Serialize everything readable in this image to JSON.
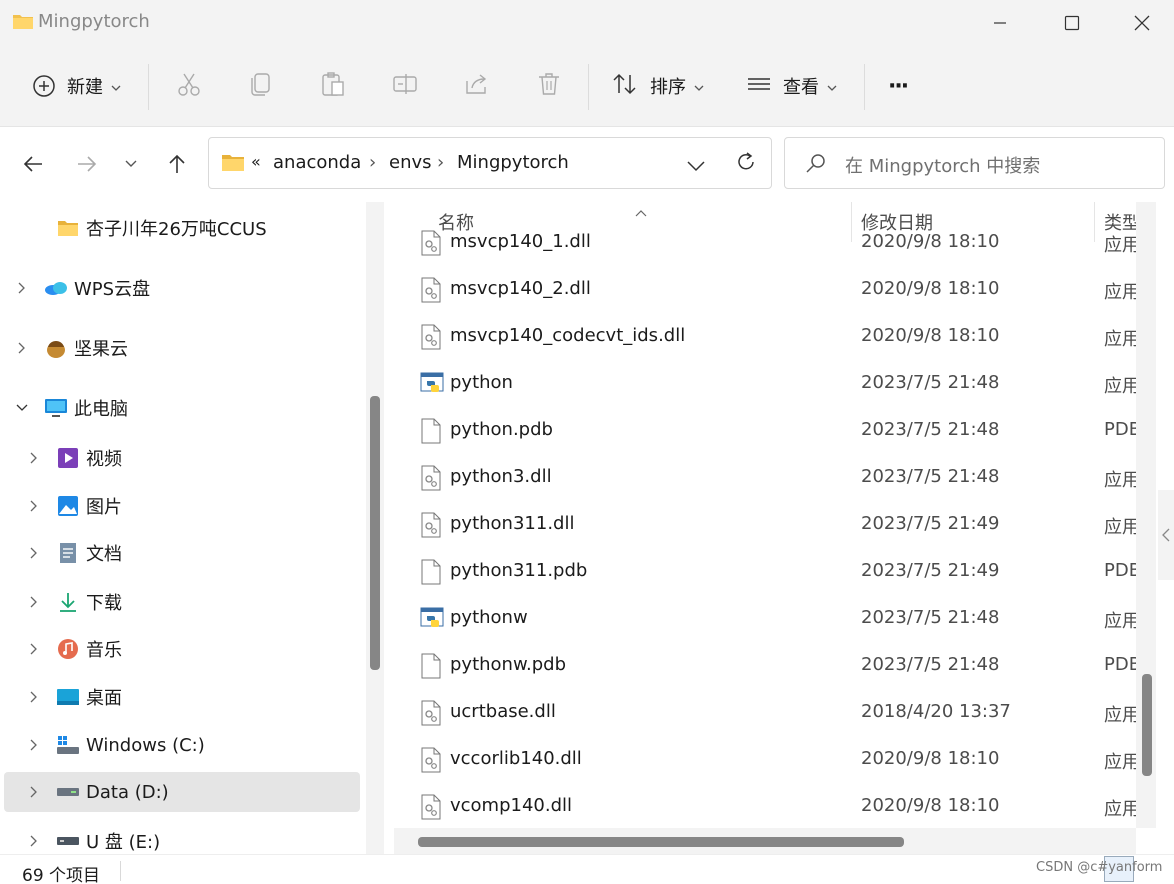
{
  "window": {
    "title": "Mingpytorch",
    "minimize_icon": "minimize-icon",
    "maximize_icon": "maximize-icon",
    "close_icon": "close-icon"
  },
  "toolbar": {
    "new_label": "新建",
    "sort_label": "排序",
    "view_label": "查看",
    "more_label": "···",
    "icons": [
      "cut-icon",
      "copy-icon",
      "paste-icon",
      "rename-icon",
      "share-icon",
      "delete-icon"
    ]
  },
  "nav": {
    "breadcrumb_overflow": "«",
    "breadcrumbs": [
      "anaconda",
      "envs",
      "Mingpytorch"
    ],
    "search_placeholder": "在 Mingpytorch 中搜索"
  },
  "sidebar": {
    "items": [
      {
        "label": "杏子川年26万吨CCUS",
        "icon": "folder-icon"
      },
      {
        "label": "WPS云盘",
        "icon": "cloud-icon"
      },
      {
        "label": "坚果云",
        "icon": "nut-icon"
      },
      {
        "label": "此电脑",
        "icon": "computer-icon"
      },
      {
        "label": "视频",
        "icon": "video-icon"
      },
      {
        "label": "图片",
        "icon": "picture-icon"
      },
      {
        "label": "文档",
        "icon": "document-icon"
      },
      {
        "label": "下载",
        "icon": "download-icon"
      },
      {
        "label": "音乐",
        "icon": "music-icon"
      },
      {
        "label": "桌面",
        "icon": "desktop-icon"
      },
      {
        "label": "Windows (C:)",
        "icon": "drive-c-icon"
      },
      {
        "label": "Data (D:)",
        "icon": "drive-icon"
      },
      {
        "label": "U 盘 (E:)",
        "icon": "usb-drive-icon"
      }
    ]
  },
  "columns": {
    "name": "名称",
    "date": "修改日期",
    "type": "类型"
  },
  "files": [
    {
      "name": "msvcp140_1.dll",
      "date": "2020/9/8 18:10",
      "type": "应用",
      "icon": "dll-icon"
    },
    {
      "name": "msvcp140_2.dll",
      "date": "2020/9/8 18:10",
      "type": "应用",
      "icon": "dll-icon"
    },
    {
      "name": "msvcp140_codecvt_ids.dll",
      "date": "2020/9/8 18:10",
      "type": "应用",
      "icon": "dll-icon"
    },
    {
      "name": "python",
      "date": "2023/7/5 21:48",
      "type": "应用",
      "icon": "python-icon"
    },
    {
      "name": "python.pdb",
      "date": "2023/7/5 21:48",
      "type": "PDB",
      "icon": "file-icon"
    },
    {
      "name": "python3.dll",
      "date": "2023/7/5 21:48",
      "type": "应用",
      "icon": "dll-icon"
    },
    {
      "name": "python311.dll",
      "date": "2023/7/5 21:49",
      "type": "应用",
      "icon": "dll-icon"
    },
    {
      "name": "python311.pdb",
      "date": "2023/7/5 21:49",
      "type": "PDB",
      "icon": "file-icon"
    },
    {
      "name": "pythonw",
      "date": "2023/7/5 21:48",
      "type": "应用",
      "icon": "python-icon"
    },
    {
      "name": "pythonw.pdb",
      "date": "2023/7/5 21:48",
      "type": "PDB",
      "icon": "file-icon"
    },
    {
      "name": "ucrtbase.dll",
      "date": "2018/4/20 13:37",
      "type": "应用",
      "icon": "dll-icon"
    },
    {
      "name": "vccorlib140.dll",
      "date": "2020/9/8 18:10",
      "type": "应用",
      "icon": "dll-icon"
    },
    {
      "name": "vcomp140.dll",
      "date": "2020/9/8 18:10",
      "type": "应用",
      "icon": "dll-icon"
    }
  ],
  "status": {
    "item_count": "69 个项目"
  },
  "watermark": "CSDN @c#yanform",
  "colors": {
    "folder": "#f2c14e",
    "chrome_bg": "#f3f3f3",
    "selected_bg": "#e5e5e5"
  }
}
